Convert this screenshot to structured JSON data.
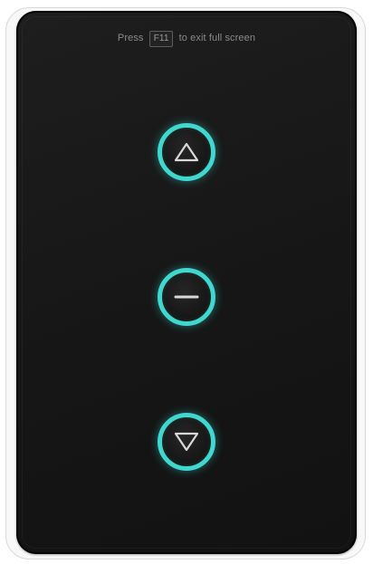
{
  "hint": {
    "prefix": "Press",
    "key": "F11",
    "suffix": "to exit full screen"
  },
  "controls": [
    {
      "name": "up-button",
      "icon": "triangle-up-icon"
    },
    {
      "name": "stop-button",
      "icon": "minus-icon"
    },
    {
      "name": "down-button",
      "icon": "triangle-down-icon"
    }
  ],
  "colors": {
    "ring": "#3fd8d0",
    "panel": "#181818",
    "icon": "#d8d8d8"
  }
}
